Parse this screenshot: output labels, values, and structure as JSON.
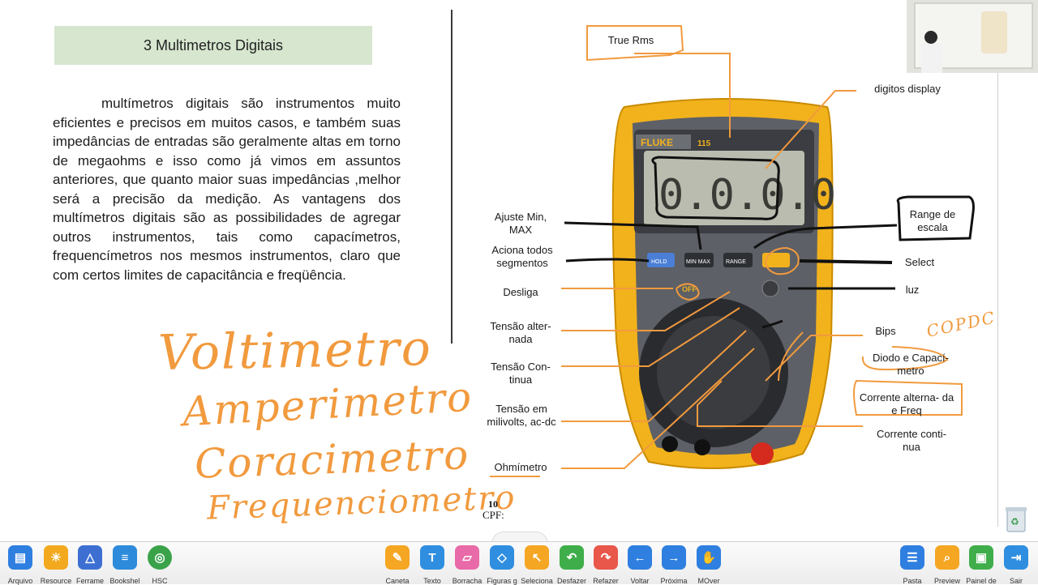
{
  "document": {
    "heading": "3 Multimetros Digitais",
    "paragraph": "multímetros digitais são instrumentos muito eficientes e precisos em muitos casos, e também suas impedâncias de entradas são geralmente altas em torno de megaohms  e isso como já vimos em assuntos anteriores, que quanto maior suas impedâncias ,melhor será a precisão da medição. As vantagens dos multímetros digitais são as possibilidades de agregar outros instrumentos, tais como capacímetros, frequencímetros nos mesmos instrumentos, claro que com certos  limites de capacitância e freqüência.",
    "page_number": "10",
    "cpf": "CPF:",
    "handwriting": [
      "Voltimetro",
      "Amperimetro",
      "Coracimetro",
      "Frequenciometro"
    ],
    "handwriting_corner": "COPDC"
  },
  "meter": {
    "brand": "FLUKE",
    "model": "115",
    "display": "0.0.0.0",
    "buttons": [
      "HOLD",
      "MIN MAX",
      "RANGE"
    ],
    "off_label": "OFF"
  },
  "labels": {
    "true_rms": "True Rms",
    "digitos_display": "digitos display",
    "range_escala": "Range de escala",
    "select": "Select",
    "luz": "luz",
    "bips": "Bips",
    "diodo": "Diodo e Capací- metro",
    "corrente_alternada": "Corrente  alterna- da e Freq",
    "corrente_continua": "Corrente conti- nua",
    "ajuste": "Ajuste Min, MAX",
    "aciona": "Aciona todos segmentos",
    "desliga": "Desliga",
    "tensao_alternada": "Tensão alter- nada",
    "tensao_continua": "Tensão Con- tinua",
    "tensao_milivolts": "Tensão    em milivolts, ac-dc",
    "ohmimetro": "Ohmímetro"
  },
  "taskbar": {
    "left": [
      {
        "label": "Arquivo",
        "icon": "folder-icon",
        "color": "#2f7fe0"
      },
      {
        "label": "Resource",
        "icon": "photos-icon",
        "color": "#f2a91e"
      },
      {
        "label": "Ferrame",
        "icon": "tools-icon",
        "color": "#3d6fd3"
      },
      {
        "label": "Bookshel",
        "icon": "bookshelf-icon",
        "color": "#2e8bdc"
      },
      {
        "label": "HSC",
        "icon": "hsc-icon",
        "color": "#3aa34a"
      }
    ],
    "center": [
      {
        "label": "Caneta",
        "icon": "pen-icon",
        "color": "#f5a623"
      },
      {
        "label": "Texto",
        "icon": "text-icon",
        "color": "#2f8ee0"
      },
      {
        "label": "Borracha",
        "icon": "eraser-icon",
        "color": "#e96aa8"
      },
      {
        "label": "Figuras g",
        "icon": "shapes-icon",
        "color": "#2f8ee0"
      },
      {
        "label": "Seleciona",
        "icon": "select-icon",
        "color": "#f5a623"
      },
      {
        "label": "Desfazer",
        "icon": "undo-icon",
        "color": "#3fae4a"
      },
      {
        "label": "Refazer",
        "icon": "redo-icon",
        "color": "#e8574a"
      },
      {
        "label": "Voltar",
        "icon": "back-icon",
        "color": "#2f7fe0"
      },
      {
        "label": "Próxima",
        "icon": "next-icon",
        "color": "#2f7fe0"
      },
      {
        "label": "MOver",
        "icon": "hand-icon",
        "color": "#2f7fe0"
      }
    ],
    "right": [
      {
        "label": "Pasta",
        "icon": "clipboard-icon",
        "color": "#2f7fe0"
      },
      {
        "label": "Preview",
        "icon": "preview-icon",
        "color": "#f5a623"
      },
      {
        "label": "Painel de",
        "icon": "panel-icon",
        "color": "#3fae4a"
      },
      {
        "label": "Sair",
        "icon": "exit-icon",
        "color": "#2f8ee0"
      }
    ]
  }
}
